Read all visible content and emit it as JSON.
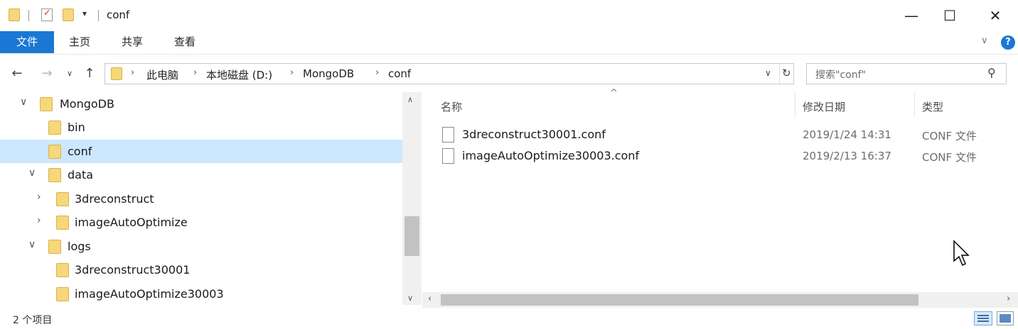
{
  "window": {
    "title": "conf",
    "controls": {
      "minimize": "—",
      "maximize": "☐",
      "close": "✕"
    }
  },
  "ribbon": {
    "tabs": [
      {
        "label": "文件",
        "active": true
      },
      {
        "label": "主页",
        "active": false
      },
      {
        "label": "共享",
        "active": false
      },
      {
        "label": "查看",
        "active": false
      }
    ],
    "help": "?"
  },
  "address": {
    "breadcrumbs": [
      "此电脑",
      "本地磁盘 (D:)",
      "MongoDB",
      "conf"
    ],
    "search_placeholder": "搜索\"conf\""
  },
  "tree": {
    "items": [
      {
        "label": "MongoDB",
        "expanded": true
      },
      {
        "label": "bin"
      },
      {
        "label": "conf",
        "selected": true
      },
      {
        "label": "data",
        "expanded": true
      },
      {
        "label": "3dreconstruct",
        "expanded": false
      },
      {
        "label": "imageAutoOptimize",
        "expanded": false
      },
      {
        "label": "logs",
        "expanded": true
      },
      {
        "label": "3dreconstruct30001"
      },
      {
        "label": "imageAutoOptimize30003"
      }
    ]
  },
  "list": {
    "columns": {
      "name": "名称",
      "date": "修改日期",
      "type": "类型"
    },
    "files": [
      {
        "name": "3dreconstruct30001.conf",
        "date": "2019/1/24 14:31",
        "type": "CONF 文件"
      },
      {
        "name": "imageAutoOptimize30003.conf",
        "date": "2019/2/13 16:37",
        "type": "CONF 文件"
      }
    ]
  },
  "status": {
    "item_count": "2 个项目"
  },
  "colors": {
    "accent": "#1a78d4",
    "selection": "#cce8ff",
    "folder": "#f6d77a"
  }
}
